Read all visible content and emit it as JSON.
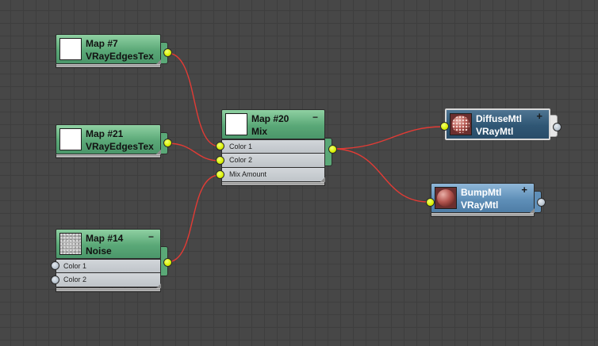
{
  "nodes": {
    "map7": {
      "title": "Map #7",
      "type": "VRayEdgesTex"
    },
    "map21": {
      "title": "Map #21",
      "type": "VRayEdgesTex"
    },
    "map14": {
      "title": "Map #14",
      "type": "Noise",
      "collapse": "−",
      "slots": [
        "Color 1",
        "Color 2"
      ]
    },
    "map20": {
      "title": "Map #20",
      "type": "Mix",
      "collapse": "−",
      "slots": [
        "Color 1",
        "Color 2",
        "Mix Amount"
      ]
    },
    "diffuse": {
      "title": "DiffuseMtl",
      "type": "VRayMtl",
      "expand": "+"
    },
    "bump": {
      "title": "BumpMtl",
      "type": "VRayMtl",
      "expand": "+"
    }
  },
  "icons": {
    "map7": "white-swatch-icon",
    "map21": "white-swatch-icon",
    "map14": "noise-swatch-icon",
    "map20": "white-swatch-icon",
    "diffuse": "material-sphere-icon",
    "bump": "material-sphere-icon"
  },
  "colors": {
    "canvas": "#474747",
    "wire": "#e23b35",
    "map_node": "#5aa877",
    "material_node": "#5f8fb8",
    "selected_material_node": "#2f5674",
    "socket_connected": "#d9f000",
    "socket_free": "#b9c4cf"
  }
}
